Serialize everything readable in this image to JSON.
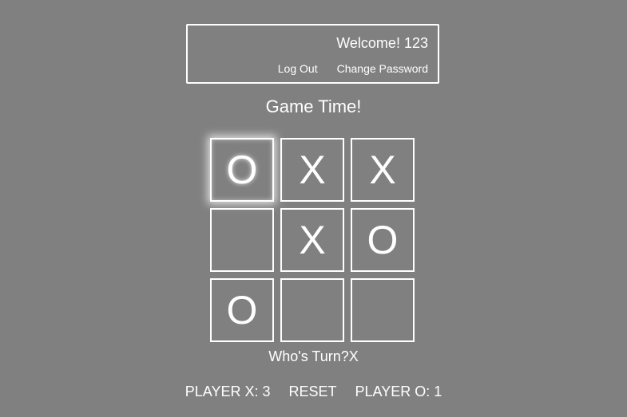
{
  "account": {
    "welcome_label": "Welcome!",
    "username": "123",
    "logout_label": "Log Out",
    "change_password_label": "Change Password"
  },
  "game": {
    "title": "Game Time!",
    "board": [
      [
        "O",
        "X",
        "X"
      ],
      [
        "",
        "X",
        "O"
      ],
      [
        "O",
        "",
        ""
      ]
    ],
    "turn_label": "Who's Turn?",
    "current_turn": "X"
  },
  "score": {
    "player_x_label": "PLAYER X:",
    "player_x_score": 3,
    "reset_label": "RESET",
    "player_o_label": "PLAYER O:",
    "player_o_score": 1
  },
  "colors": {
    "background": "#808080",
    "foreground": "#ffffff"
  }
}
